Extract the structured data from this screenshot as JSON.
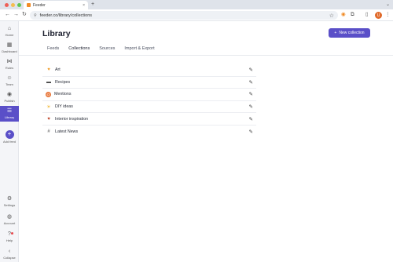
{
  "browser": {
    "tab_title": "Feeder",
    "tab_close": "×",
    "new_tab": "+",
    "tab_dropdown": "⌄",
    "url": "feeder.co/library/collections",
    "avatar_initial": "U",
    "traffic_lights": [
      "#ee5f57",
      "#f5bd4f",
      "#5fc553"
    ]
  },
  "sidebar": {
    "items": [
      {
        "label": "Home",
        "icon": "home-icon",
        "glyph": "⌂"
      },
      {
        "label": "Dashboard",
        "icon": "dashboard-icon",
        "glyph": "▦"
      },
      {
        "label": "Rules",
        "icon": "share-icon",
        "glyph": "⋈"
      },
      {
        "label": "Team",
        "icon": "team-icon",
        "glyph": "☺"
      },
      {
        "label": "Publish",
        "icon": "publish-icon",
        "glyph": "◉"
      },
      {
        "label": "Library",
        "icon": "library-icon",
        "glyph": "☰"
      },
      {
        "label": "Add feed",
        "icon": "plus-icon",
        "glyph": "+"
      },
      {
        "label": "Settings",
        "icon": "gear-icon",
        "glyph": "⚙"
      },
      {
        "label": "Account",
        "icon": "account-icon",
        "glyph": "◍"
      },
      {
        "label": "Help",
        "icon": "help-icon",
        "glyph": "?"
      },
      {
        "label": "Collapse",
        "icon": "chevron-left-icon",
        "glyph": "‹"
      }
    ],
    "active": "Library"
  },
  "main": {
    "title": "Library",
    "new_button": "New collection",
    "new_button_icon": "+",
    "accent": "#5a4fc8",
    "tabs": [
      {
        "label": "Feeds"
      },
      {
        "label": "Collections"
      },
      {
        "label": "Sources"
      },
      {
        "label": "Import & Export"
      }
    ],
    "active_tab": "Collections",
    "collections": [
      {
        "name": "Art",
        "icon": "heart-icon",
        "glyph": "♥"
      },
      {
        "name": "Recipes",
        "icon": "recipes-icon",
        "glyph": "▬"
      },
      {
        "name": "Mentions",
        "icon": "mentions-icon",
        "glyph": "@"
      },
      {
        "name": "DIY ideas",
        "icon": "sun-icon",
        "glyph": "☀"
      },
      {
        "name": "Interior inspiration",
        "icon": "heart-icon",
        "glyph": "♥"
      },
      {
        "name": "Latest News",
        "icon": "hash-icon",
        "glyph": "#"
      }
    ],
    "edit_glyph": "✎"
  }
}
